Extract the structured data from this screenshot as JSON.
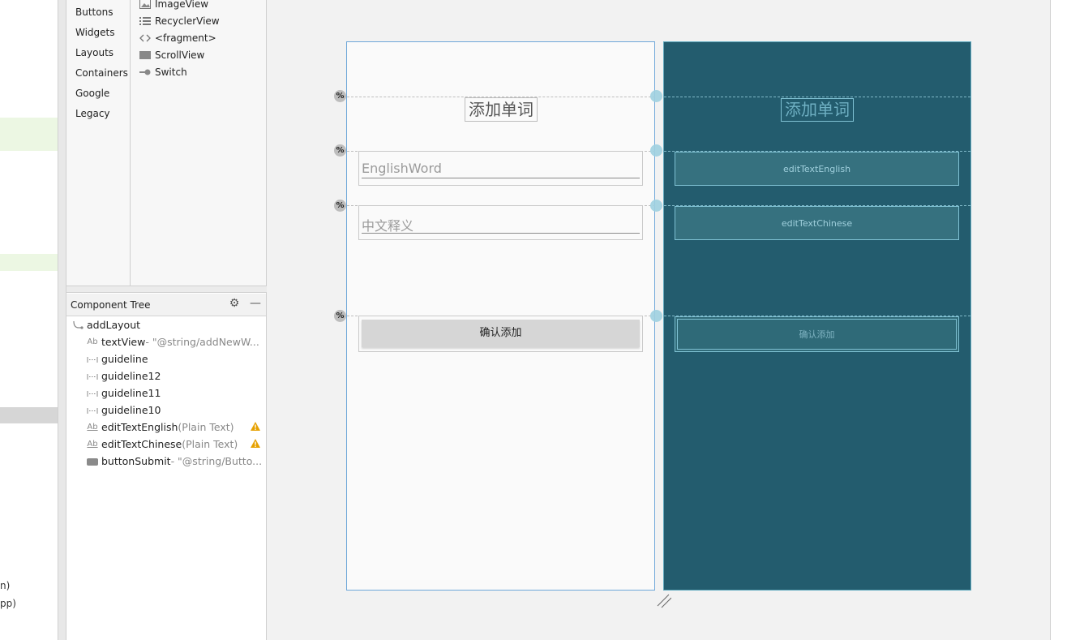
{
  "left_editor": {
    "cut_text_1": "n)",
    "cut_text_2": "pp)"
  },
  "palette": {
    "categories": [
      "Buttons",
      "Widgets",
      "Layouts",
      "Containers",
      "Google",
      "Legacy"
    ],
    "items": [
      {
        "label": "ImageView",
        "icon": "image-icon"
      },
      {
        "label": "RecyclerView",
        "icon": "list-icon"
      },
      {
        "label": "<fragment>",
        "icon": "code-brackets-icon"
      },
      {
        "label": "ScrollView",
        "icon": "scrollview-icon"
      },
      {
        "label": "Switch",
        "icon": "switch-icon"
      }
    ]
  },
  "component_tree": {
    "title": "Component Tree",
    "rows": [
      {
        "name": "addLayout",
        "sub": "",
        "icon": "constraint-layout-icon",
        "warning": false
      },
      {
        "name": "textView",
        "sub": "- \"@string/addNewW...",
        "icon": "textview-icon",
        "warning": false
      },
      {
        "name": "guideline",
        "sub": "",
        "icon": "guideline-icon",
        "warning": false
      },
      {
        "name": "guideline12",
        "sub": "",
        "icon": "guideline-icon",
        "warning": false
      },
      {
        "name": "guideline11",
        "sub": "",
        "icon": "guideline-icon",
        "warning": false
      },
      {
        "name": "guideline10",
        "sub": "",
        "icon": "guideline-icon",
        "warning": false
      },
      {
        "name": "editTextEnglish",
        "sub": "(Plain Text)",
        "icon": "edittext-icon",
        "warning": true
      },
      {
        "name": "editTextChinese",
        "sub": "(Plain Text)",
        "icon": "edittext-icon",
        "warning": true
      },
      {
        "name": "buttonSubmit",
        "sub": "- \"@string/Butto...",
        "icon": "button-icon",
        "warning": false
      }
    ]
  },
  "design": {
    "title": "添加单词",
    "english_hint": "EnglishWord",
    "chinese_hint": "中文释义",
    "button_label": "确认添加",
    "guideline_badge": "%"
  },
  "blueprint": {
    "title": "添加单词",
    "edit_english_id": "editTextEnglish",
    "edit_chinese_id": "editTextChinese",
    "button_label": "确认添加"
  },
  "colors": {
    "blueprint_bg": "#235c6e",
    "selection_border": "#6ea7d9",
    "warning": "#e6a100"
  }
}
